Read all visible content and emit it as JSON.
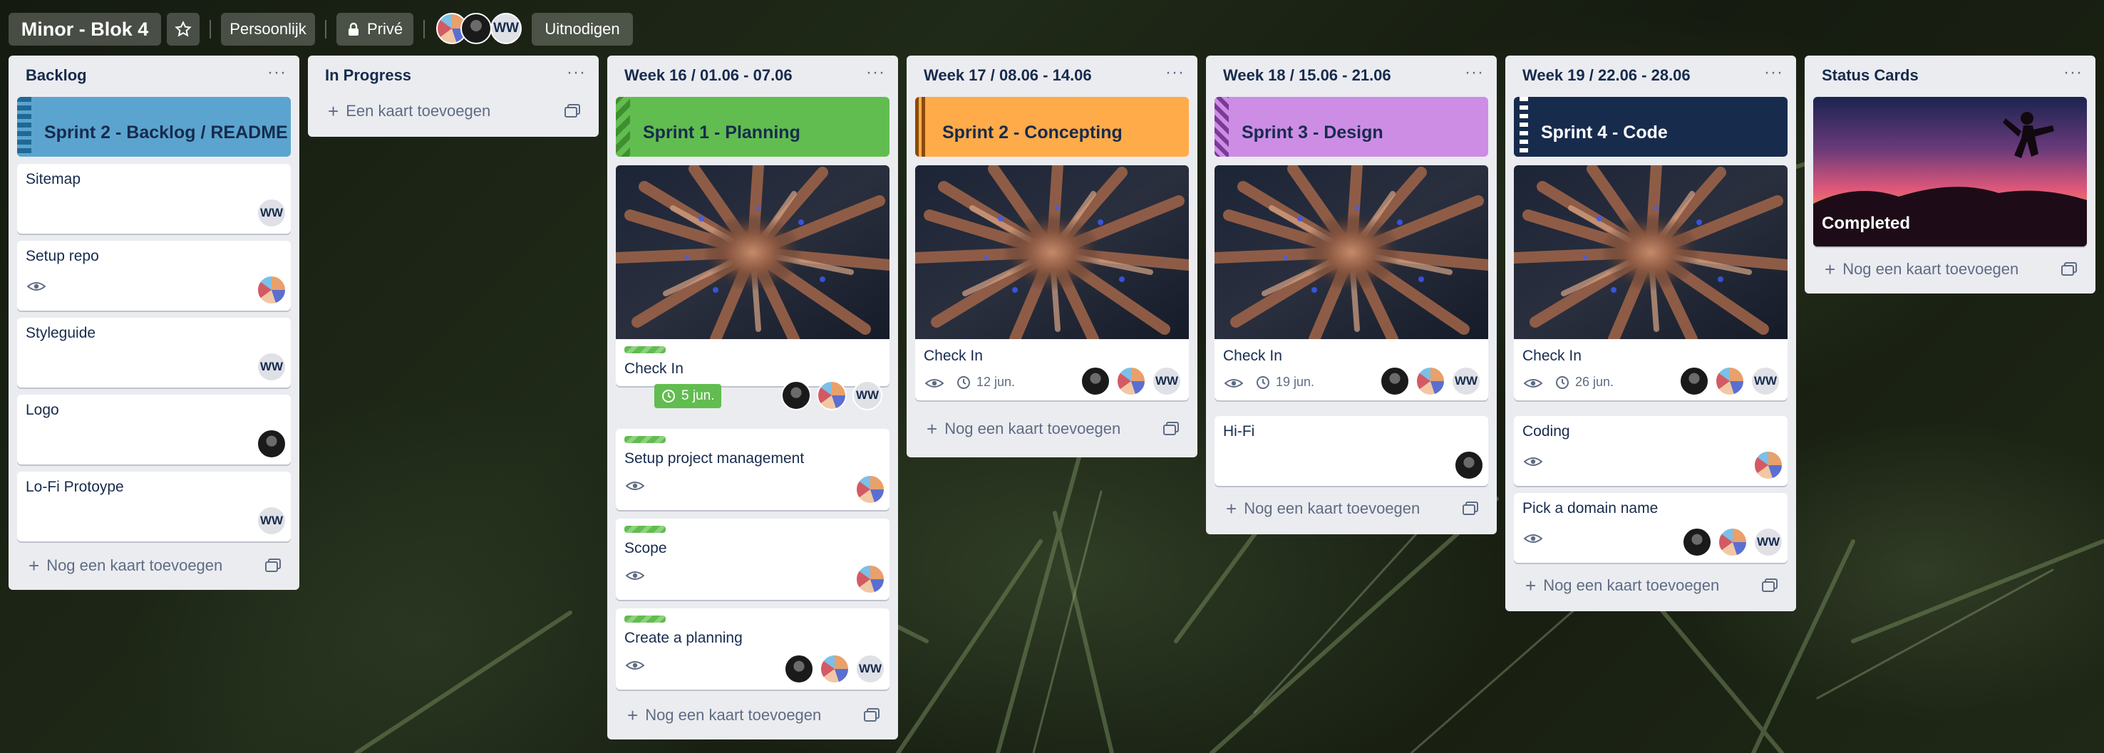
{
  "board": {
    "title": "Minor - Blok 4",
    "personal_label": "Persoonlijk",
    "privacy_label": "Privé",
    "invite_label": "Uitnodigen",
    "member_initials": "WW"
  },
  "lists": {
    "backlog": {
      "title": "Backlog",
      "cover": "Sprint 2 - Backlog / README",
      "cover_color": "#5ba4cf",
      "cards": [
        "Sitemap",
        "Setup repo",
        "Styleguide",
        "Logo",
        "Lo-Fi Protoype"
      ],
      "add": "Nog een kaart toevoegen"
    },
    "in_progress": {
      "title": "In Progress",
      "add": "Een kaart toevoegen"
    },
    "week16": {
      "title": "Week 16 / 01.06 - 07.06",
      "cover": "Sprint 1 - Planning",
      "cover_color": "#61bd4f",
      "checkin": "Check In",
      "due": "5 jun.",
      "cards": [
        "Setup project management",
        "Scope",
        "Create a planning"
      ],
      "add": "Nog een kaart toevoegen"
    },
    "week17": {
      "title": "Week 17 / 08.06 - 14.06",
      "cover": "Sprint 2 - Concepting",
      "cover_color": "#ffab4a",
      "checkin": "Check In",
      "date": "12 jun.",
      "add": "Nog een kaart toevoegen"
    },
    "week18": {
      "title": "Week 18 / 15.06 - 21.06",
      "cover": "Sprint 3 - Design",
      "cover_color": "#cd8de5",
      "checkin": "Check In",
      "date": "19 jun.",
      "cards": [
        "Hi-Fi"
      ],
      "add": "Nog een kaart toevoegen"
    },
    "week19": {
      "title": "Week 19 / 22.06 - 28.06",
      "cover": "Sprint 4 - Code",
      "cover_color": "#172b4d",
      "checkin": "Check In",
      "date": "26 jun.",
      "cards": [
        "Coding",
        "Pick a domain name"
      ],
      "add": "Nog een kaart toevoegen"
    },
    "status": {
      "title": "Status Cards",
      "completed": "Completed",
      "add": "Nog een kaart toevoegen"
    }
  },
  "icons": {
    "menu": "more-horizontal-icon",
    "star": "star-icon",
    "lock": "lock-icon",
    "watch": "eye-icon",
    "clock": "clock-icon",
    "template": "card-template-icon"
  }
}
